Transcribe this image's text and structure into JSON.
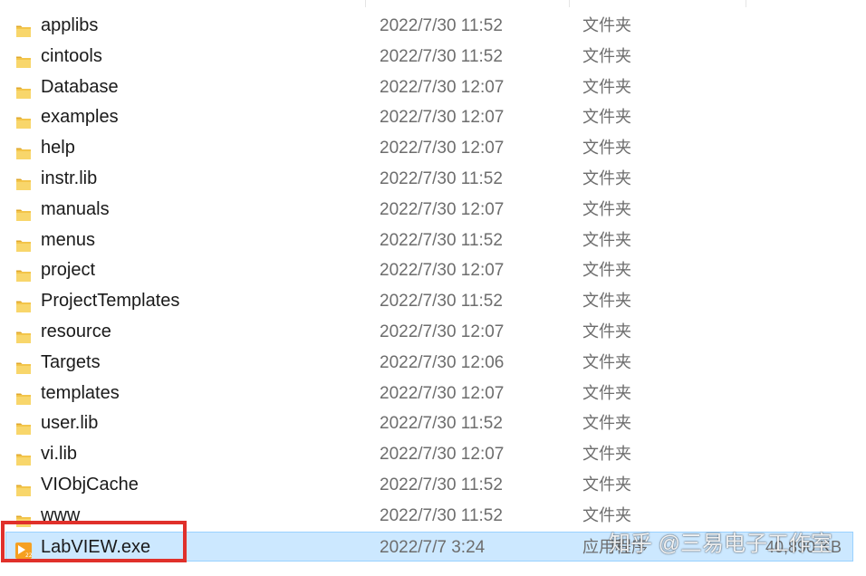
{
  "files": [
    {
      "name": "applibs",
      "modified": "2022/7/30 11:52",
      "type": "文件夹",
      "size": ""
    },
    {
      "name": "cintools",
      "modified": "2022/7/30 11:52",
      "type": "文件夹",
      "size": ""
    },
    {
      "name": "Database",
      "modified": "2022/7/30 12:07",
      "type": "文件夹",
      "size": ""
    },
    {
      "name": "examples",
      "modified": "2022/7/30 12:07",
      "type": "文件夹",
      "size": ""
    },
    {
      "name": "help",
      "modified": "2022/7/30 12:07",
      "type": "文件夹",
      "size": ""
    },
    {
      "name": "instr.lib",
      "modified": "2022/7/30 11:52",
      "type": "文件夹",
      "size": ""
    },
    {
      "name": "manuals",
      "modified": "2022/7/30 12:07",
      "type": "文件夹",
      "size": ""
    },
    {
      "name": "menus",
      "modified": "2022/7/30 11:52",
      "type": "文件夹",
      "size": ""
    },
    {
      "name": "project",
      "modified": "2022/7/30 12:07",
      "type": "文件夹",
      "size": ""
    },
    {
      "name": "ProjectTemplates",
      "modified": "2022/7/30 11:52",
      "type": "文件夹",
      "size": ""
    },
    {
      "name": "resource",
      "modified": "2022/7/30 12:07",
      "type": "文件夹",
      "size": ""
    },
    {
      "name": "Targets",
      "modified": "2022/7/30 12:06",
      "type": "文件夹",
      "size": ""
    },
    {
      "name": "templates",
      "modified": "2022/7/30 12:07",
      "type": "文件夹",
      "size": ""
    },
    {
      "name": "user.lib",
      "modified": "2022/7/30 11:52",
      "type": "文件夹",
      "size": ""
    },
    {
      "name": "vi.lib",
      "modified": "2022/7/30 12:07",
      "type": "文件夹",
      "size": ""
    },
    {
      "name": "VIObjCache",
      "modified": "2022/7/30 11:52",
      "type": "文件夹",
      "size": ""
    },
    {
      "name": "www",
      "modified": "2022/7/30 11:52",
      "type": "文件夹",
      "size": ""
    },
    {
      "name": "LabVIEW.exe",
      "modified": "2022/7/7 3:24",
      "type": "应用程序",
      "size": "40,890 KB",
      "selected": true,
      "icon": "labview-app-icon",
      "icon_label": "22"
    }
  ],
  "folder_icon": "folder-icon",
  "colors": {
    "folder": "#f3c54a",
    "folder_dark": "#e0a82e",
    "selection": "#cce8ff",
    "selection_border": "#99d1ff",
    "highlight": "#e0302a",
    "app_icon": "#f6a021"
  },
  "watermark": "知乎 @三易电子工作室"
}
